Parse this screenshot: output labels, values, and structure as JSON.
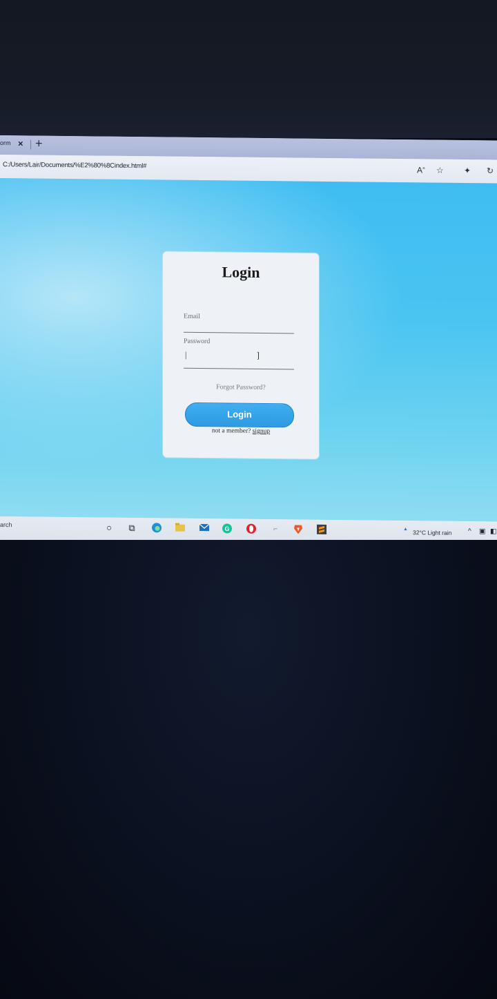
{
  "browser": {
    "tab_partial_title": "orm",
    "tab_close": "×",
    "new_tab": "+",
    "url": "C:/Users/Lair/Documents/%E2%80%8Cindex.html#",
    "icons": [
      "read-aloud-icon",
      "favorite-icon",
      "extensions-icon",
      "refresh-icon"
    ]
  },
  "page": {
    "title": "Login",
    "email_label": "Email",
    "password_label": "Password",
    "password_bracket": "]",
    "forgot": "Forgot Password?",
    "login_button": "Login",
    "signup_prompt": "not a member?",
    "signup_link": "signup"
  },
  "taskbar": {
    "search_partial": "arch",
    "icons": [
      "cortana-icon",
      "task-view-icon",
      "edge-icon",
      "file-explorer-icon",
      "mail-icon",
      "grammarly-icon",
      "opera-icon",
      "notepad-icon",
      "brave-icon",
      "sublime-icon"
    ],
    "weather": "32°C  Light rain",
    "tray_arrow": "^"
  },
  "colors": {
    "viewport_top": "#3fbdf2",
    "viewport_bottom": "#8fdcf1",
    "button": "#2d9ae2",
    "card": "#eef1f5"
  }
}
